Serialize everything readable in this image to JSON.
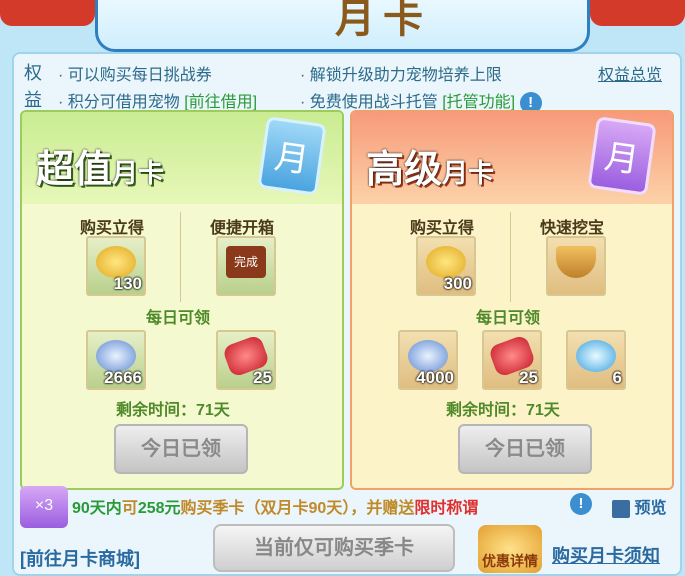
{
  "banner": {
    "title": "月卡"
  },
  "rights": {
    "tag_line1": "权",
    "tag_line2": "益",
    "item1": "· 可以购买每日挑战券",
    "item2": "· 解锁升级助力宠物培养上限",
    "item3_text": "· 积分可借用宠物 ",
    "item3_link": "[前往借用]",
    "item4_text": "· 免费使用战斗托管 ",
    "item4_link": "[托管功能]",
    "overview_link": "权益总览"
  },
  "card_value": {
    "title_big": "超值",
    "title_small": "月卡",
    "icon_text": "月",
    "buy_label": "购买立得",
    "quick_label": "便捷开箱",
    "buy_count": "130",
    "quick_stamp": "完成",
    "daily_label": "每日可领",
    "daily1_count": "2666",
    "daily2_count": "25",
    "remain": "剩余时间：71天",
    "button": "今日已领"
  },
  "card_premium": {
    "title_big": "高级",
    "title_small": "月卡",
    "icon_text": "月",
    "buy_label": "购买立得",
    "dig_label": "快速挖宝",
    "buy_count": "300",
    "daily_label": "每日可领",
    "daily1_count": "4000",
    "daily2_count": "25",
    "daily3_count": "6",
    "remain": "剩余时间：71天",
    "button": "今日已领"
  },
  "promo": {
    "p1": "90天内",
    "p2": "可",
    "p3": "258元",
    "p4": "购买季卡（双月卡90天），并赠送",
    "p5": "限时称谓",
    "preview": "预览",
    "card_badge": "×3"
  },
  "bottom": {
    "shop_link": "[前往月卡商城]",
    "buy_season": "当前仅可购买季卡",
    "discount": "优惠详情",
    "notice_link": "购买月卡须知"
  }
}
